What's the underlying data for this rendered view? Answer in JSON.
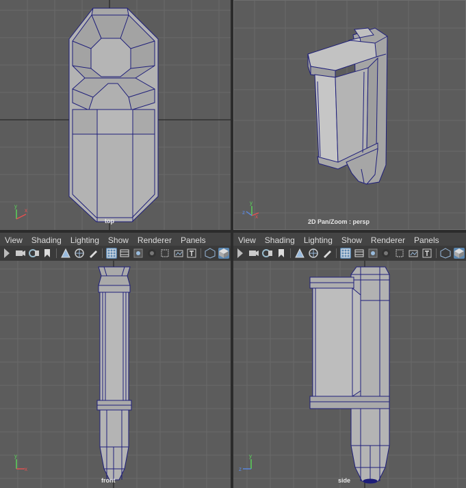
{
  "viewports": {
    "top": {
      "label": "top"
    },
    "persp": {
      "label": "2D Pan/Zoom : persp"
    },
    "front": {
      "label": "front"
    },
    "side": {
      "label": "side"
    }
  },
  "menu": [
    "View",
    "Shading",
    "Lighting",
    "Show",
    "Renderer",
    "Panels"
  ],
  "axes": {
    "x": "x",
    "y": "y",
    "z": "z"
  },
  "colors": {
    "viewport_bg": "#5c5c5c",
    "grid_line": "#6a6a6a",
    "grid_axis": "#303030",
    "mesh_fill": "#b3b3b3",
    "mesh_wire": "#1e1e7a",
    "menu_bg": "#444444",
    "toolbar_bg": "#3a3a3a",
    "toggle_on": "#5a86b0"
  },
  "toolbar_icons": [
    "camera-select-icon",
    "camera-icon",
    "camera-attributes-icon",
    "bookmark-icon",
    "image-plane-icon",
    "2d-pan-zoom-icon",
    "grease-pencil-icon",
    "grid-icon",
    "film-gate-icon",
    "resolution-gate-icon",
    "safe-action-icon",
    "wireframe-icon",
    "smooth-shade-icon",
    "textured-icon",
    "lights-icon",
    "xray-icon",
    "isolate-icon",
    "shaded-cube-icon"
  ]
}
